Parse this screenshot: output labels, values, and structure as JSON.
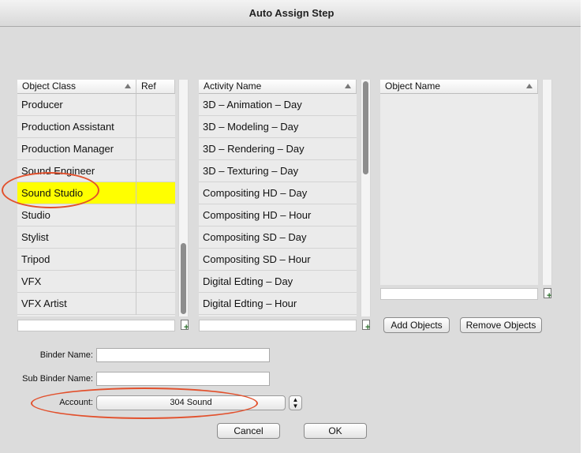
{
  "window": {
    "title": "Auto Assign Step"
  },
  "object_class_table": {
    "columns": {
      "object_class": "Object Class",
      "ref": "Ref"
    },
    "rows": [
      "Producer",
      "Production Assistant",
      "Production Manager",
      "Sound Engineer",
      "Sound Studio",
      "Studio",
      "Stylist",
      "Tripod",
      "VFX",
      "VFX Artist"
    ],
    "selected": "Sound Studio"
  },
  "activity_table": {
    "column": "Activity Name",
    "rows": [
      "3D – Animation – Day",
      "3D – Modeling – Day",
      "3D – Rendering – Day",
      "3D – Texturing – Day",
      "Compositing HD – Day",
      "Compositing HD – Hour",
      "Compositing SD – Day",
      "Compositing SD – Hour",
      "Digital Edting – Day",
      "Digital Edting – Hour"
    ]
  },
  "object_name_table": {
    "column": "Object Name"
  },
  "buttons": {
    "add_objects": "Add Objects",
    "remove_objects": "Remove Objects",
    "cancel": "Cancel",
    "ok": "OK"
  },
  "form": {
    "binder_name_label": "Binder Name:",
    "binder_name_value": "",
    "sub_binder_name_label": "Sub Binder Name:",
    "sub_binder_name_value": "",
    "account_label": "Account:",
    "account_value": "304 Sound"
  },
  "colors": {
    "selection": "#ffff00",
    "annotation": "#e2502c"
  }
}
